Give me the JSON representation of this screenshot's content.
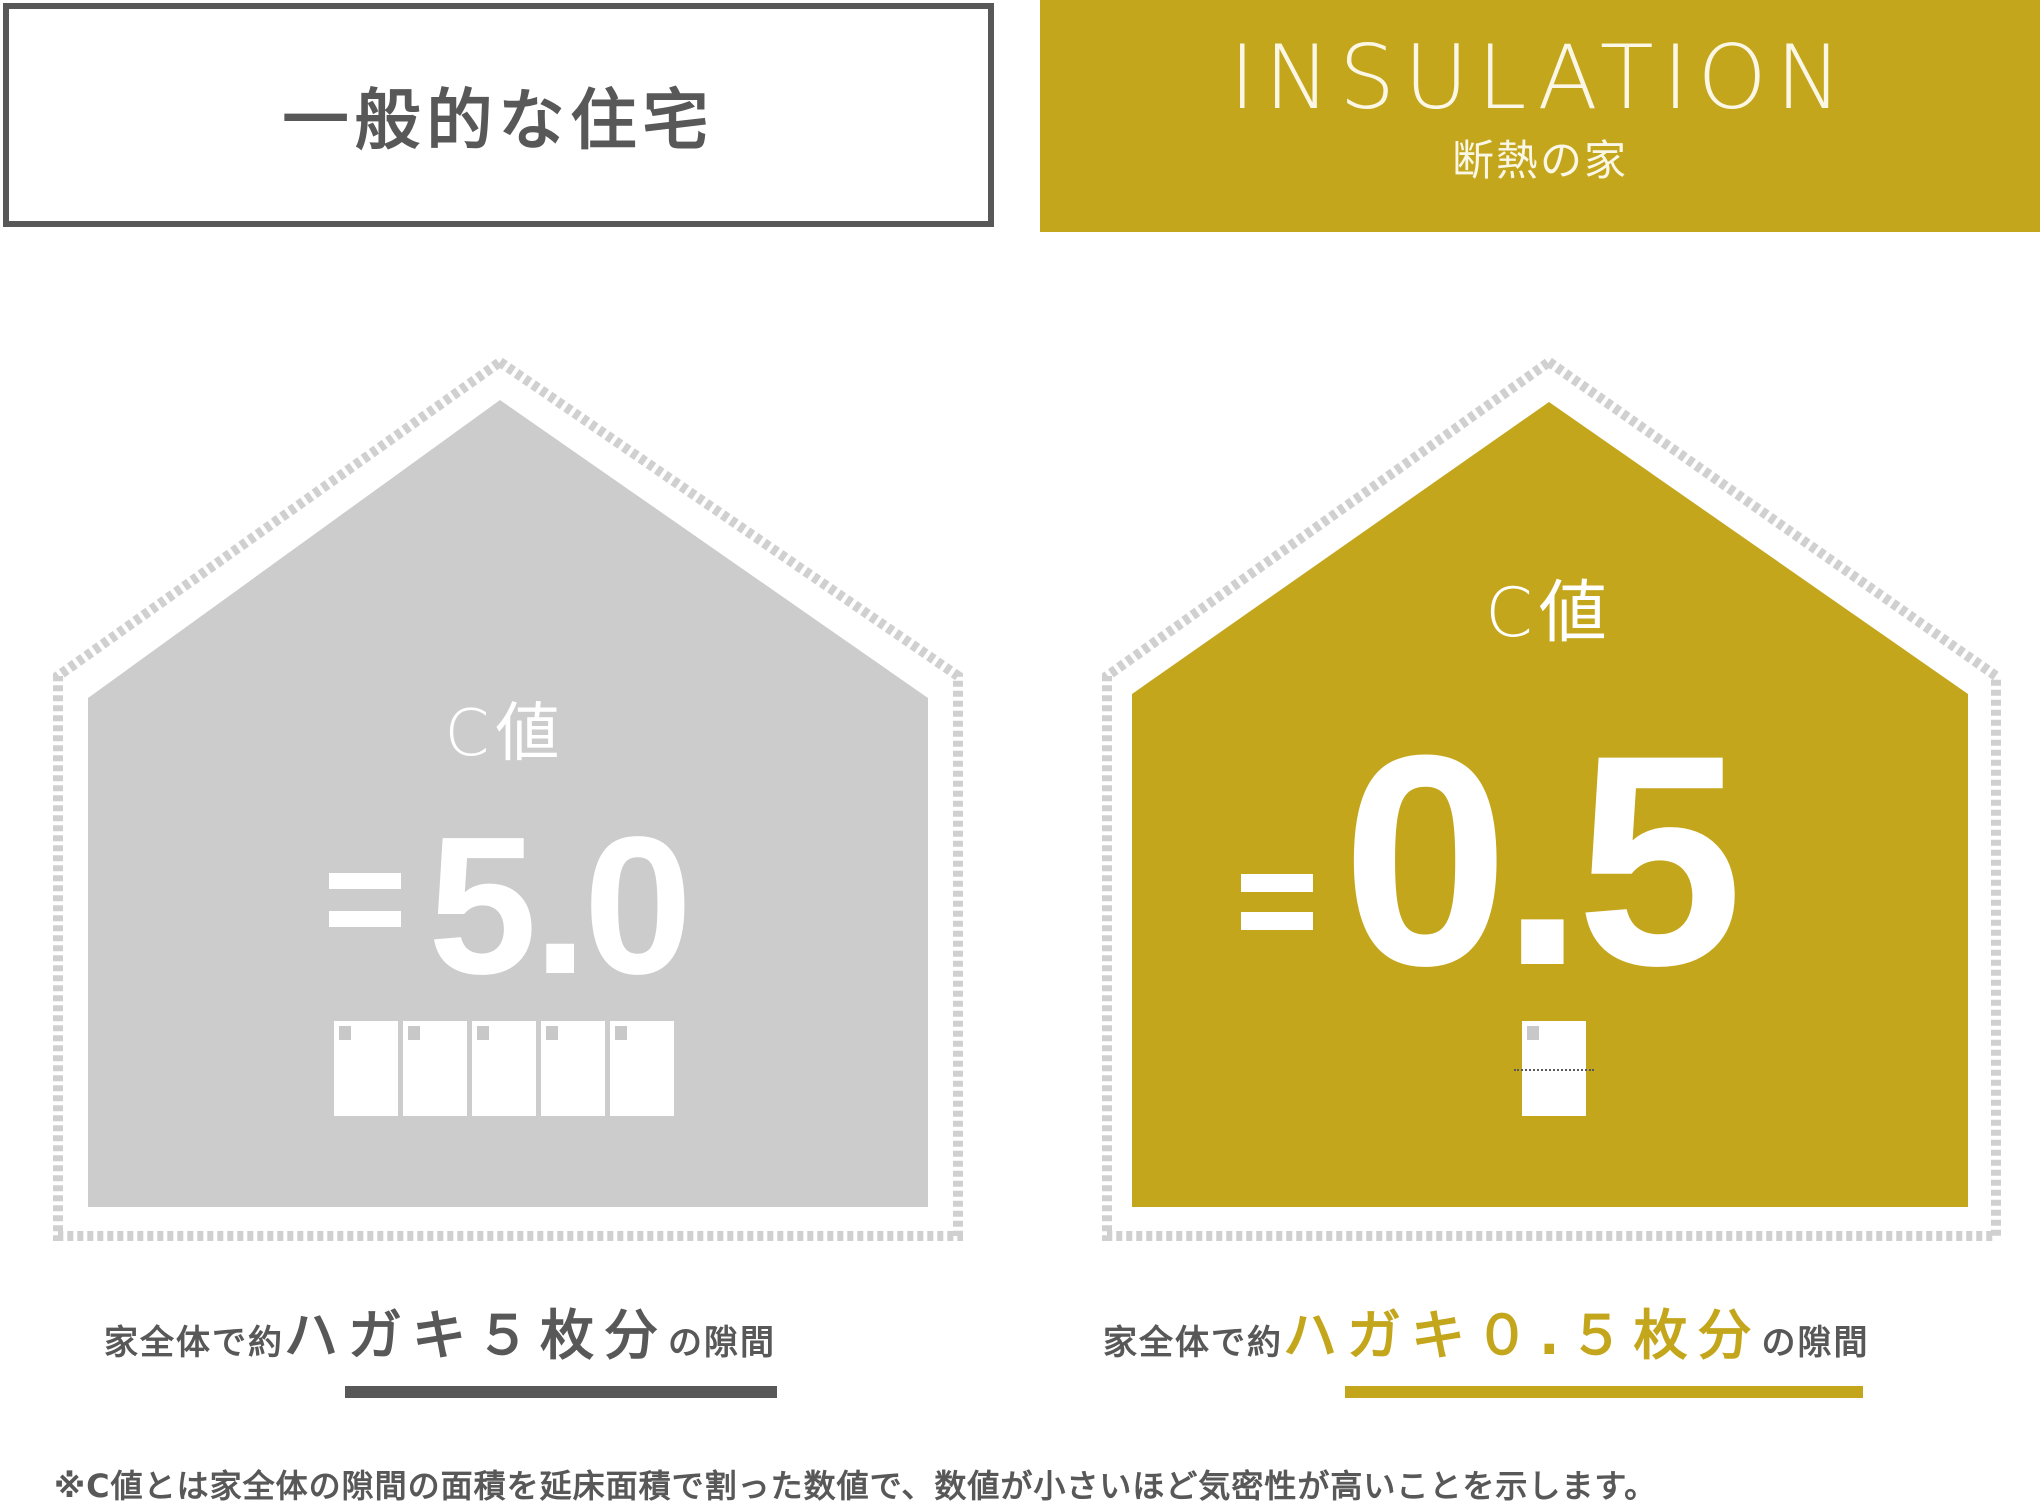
{
  "header": {
    "left_title": "一般的な住宅",
    "right_title": "INSULATION",
    "right_subtitle": "断熱の家"
  },
  "colors": {
    "gold": "#c4a61c",
    "gray_fill": "#cccccc",
    "outline": "#d0d0d0",
    "dark_text": "#585858"
  },
  "general_house": {
    "label": "C値",
    "equals": "=",
    "value": "5.0",
    "postcard_count": 5,
    "caption_prefix": "家全体で約",
    "caption_highlight": "ハガキ５枚分",
    "caption_suffix": "の隙間"
  },
  "insulation_house": {
    "label": "C値",
    "equals": "=",
    "value": "0.5",
    "postcard_count": 0.5,
    "caption_prefix": "家全体で約",
    "caption_highlight": "ハガキ０.５枚分",
    "caption_suffix": "の隙間"
  },
  "footnote": "※C値とは家全体の隙間の面積を延床面積で割った数値で、数値が小さいほど気密性が高いことを示します。"
}
